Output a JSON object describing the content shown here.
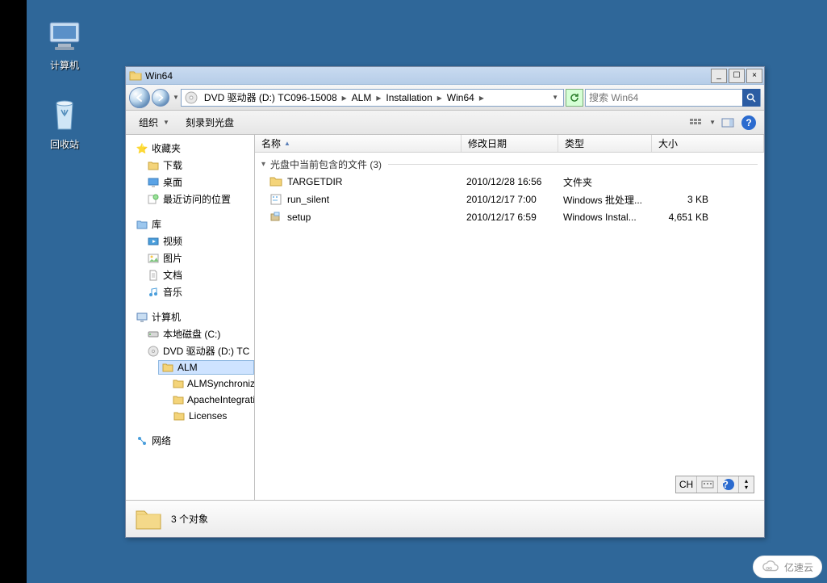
{
  "desktop": {
    "icons": {
      "computer": "计算机",
      "recycle": "回收站"
    }
  },
  "window": {
    "title": "Win64",
    "controls": {
      "min": "_",
      "max": "☐",
      "close": "×"
    },
    "breadcrumbs": {
      "root": "DVD 驱动器 (D:) TC096-15008",
      "alm": "ALM",
      "inst": "Installation",
      "win64": "Win64"
    },
    "search_placeholder": "搜索 Win64",
    "toolbar": {
      "organize": "组织",
      "burn": "刻录到光盘"
    },
    "columns": {
      "name": "名称",
      "modified": "修改日期",
      "type": "类型",
      "size": "大小"
    },
    "group_header": "光盘中当前包含的文件 (3)",
    "files": [
      {
        "name": "TARGETDIR",
        "date": "2010/12/28 16:56",
        "type": "文件夹",
        "size": ""
      },
      {
        "name": "run_silent",
        "date": "2010/12/17 7:00",
        "type": "Windows 批处理...",
        "size": "3 KB"
      },
      {
        "name": "setup",
        "date": "2010/12/17 6:59",
        "type": "Windows Instal...",
        "size": "4,651 KB"
      }
    ],
    "status": "3 个对象",
    "ime": {
      "ch": "CH"
    }
  },
  "tree": {
    "favorites": {
      "label": "收藏夹",
      "downloads": "下载",
      "desktop": "桌面",
      "recent": "最近访问的位置"
    },
    "libraries": {
      "label": "库",
      "videos": "视频",
      "pictures": "图片",
      "documents": "文档",
      "music": "音乐"
    },
    "computer": {
      "label": "计算机",
      "c": "本地磁盘 (C:)",
      "d": "DVD 驱动器 (D:) TC",
      "alm": "ALM",
      "sync": "ALMSynchronizer",
      "apache": "ApacheIntegratio",
      "lic": "Licenses"
    },
    "network": "网络"
  },
  "watermark": "亿速云"
}
